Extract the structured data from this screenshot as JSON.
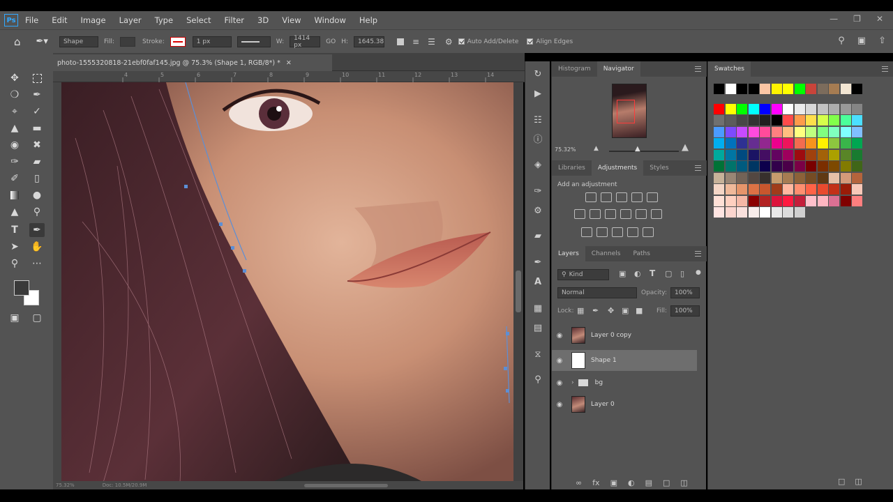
{
  "menu": [
    "File",
    "Edit",
    "Image",
    "Layer",
    "Type",
    "Select",
    "Filter",
    "3D",
    "View",
    "Window",
    "Help"
  ],
  "app_logo": "Ps",
  "options": {
    "mode": "Shape",
    "fill_label": "Fill:",
    "stroke_label": "Stroke:",
    "stroke_width": "1 px",
    "w_label": "W:",
    "w_value": "1414 px",
    "link_label": "GO",
    "h_label": "H:",
    "h_value": "1645.38",
    "auto_add_delete": "Auto Add/Delete",
    "align_edges": "Align Edges"
  },
  "document": {
    "tab_title": "photo-1555320818-21ebf0faf145.jpg @ 75.3% (Shape 1, RGB/8*) *",
    "status_zoom": "75.32%",
    "status_doc": "Doc: 10.5M/20.9M"
  },
  "ruler_ticks": [
    "4",
    "5",
    "6",
    "7",
    "8",
    "9",
    "10",
    "11",
    "12",
    "13",
    "14"
  ],
  "navigator": {
    "tabs": [
      "Histogram",
      "Navigator"
    ],
    "active": "Navigator",
    "zoom": "75.32%"
  },
  "adjustments": {
    "tabs": [
      "Libraries",
      "Adjustments",
      "Styles"
    ],
    "active": "Adjustments",
    "add_label": "Add an adjustment"
  },
  "layers_panel": {
    "tabs": [
      "Layers",
      "Channels",
      "Paths"
    ],
    "active": "Layers",
    "filter_kind": "Kind",
    "blend_mode": "Normal",
    "opacity_label": "Opacity:",
    "opacity_value": "100%",
    "lock_label": "Lock:",
    "fill_label": "Fill:",
    "fill_value": "100%",
    "layers": [
      {
        "name": "Layer 0 copy",
        "selected": false
      },
      {
        "name": "Shape 1",
        "selected": true
      },
      {
        "name": "bg",
        "selected": false
      },
      {
        "name": "Layer 0",
        "selected": false
      }
    ]
  },
  "swatches": {
    "title": "Swatches",
    "rows": [
      [
        "#000000",
        "#ffffff",
        "#000000",
        "#000000",
        "#fbc6a4",
        "#fff200",
        "#ffff00",
        "#00ff00",
        "#c8443a",
        "#7c6c5c",
        "#a67c52",
        "#f3e6d3",
        "#000000"
      ],
      [
        "#ff0000",
        "#ffff00",
        "#00ff00",
        "#00ffff",
        "#0000ff",
        "#ff00ff",
        "#ffffff",
        "#ebebeb",
        "#d7d7d7",
        "#c2c2c2",
        "#adadad",
        "#999999",
        "#858585"
      ],
      [
        "#707070",
        "#5c5c5c",
        "#474747",
        "#333333",
        "#1f1f1f",
        "#000000",
        "#ff4b4b",
        "#ff9b4b",
        "#ffdf4b",
        "#d6ff4b",
        "#82ff4b",
        "#4bff9b",
        "#4bdfff"
      ],
      [
        "#4b9bff",
        "#7c4bff",
        "#c84bff",
        "#ff4bdf",
        "#ff4b9b",
        "#ff8080",
        "#ffbf80",
        "#ffff80",
        "#bfff80",
        "#80ff80",
        "#80ffbf",
        "#80ffff",
        "#80bfff"
      ],
      [
        "#00aeef",
        "#0072bc",
        "#2e3192",
        "#662d91",
        "#92278f",
        "#ec008c",
        "#ed145b",
        "#f26c4f",
        "#f7941d",
        "#fff200",
        "#8dc63f",
        "#39b54a",
        "#00a651"
      ],
      [
        "#00a99d",
        "#0076a3",
        "#004a80",
        "#1b1464",
        "#440e62",
        "#630460",
        "#9e005d",
        "#9e0b0f",
        "#a0410d",
        "#a36209",
        "#aba000",
        "#598527",
        "#197b30"
      ],
      [
        "#007236",
        "#00746b",
        "#005b7f",
        "#003663",
        "#0d004c",
        "#32004b",
        "#4b0049",
        "#7b0046",
        "#790000",
        "#7b2e00",
        "#7d4900",
        "#827b00",
        "#406618"
      ],
      [
        "#c7b299",
        "#998675",
        "#736357",
        "#534741",
        "#37302d",
        "#c69c6d",
        "#a67c52",
        "#8c6239",
        "#754c24",
        "#603913",
        "#e6c0a8",
        "#d49a7a",
        "#b5643c"
      ],
      [
        "#f5d6c6",
        "#f0b99a",
        "#e6956b",
        "#dc7245",
        "#c8562d",
        "#a03c1a",
        "#ffb8a0",
        "#ff8f70",
        "#ff6347",
        "#e84a2e",
        "#c23018",
        "#9a1c08",
        "#f8c8b8"
      ],
      [
        "#ffe0d6",
        "#ffd0c0",
        "#f5b8a6",
        "#8b0000",
        "#b22222",
        "#dc143c",
        "#ff1a40",
        "#c41e3a",
        "#ffc0cb",
        "#ffb6c1",
        "#db7093",
        "#800000",
        "#ff7f7f"
      ],
      [
        "#ffe4e1",
        "#fcd5ce",
        "#fae1dd",
        "#f8edeb",
        "#ffffff",
        "#e8e8e8",
        "#dcdcdc",
        "#d0d0d0"
      ]
    ]
  }
}
